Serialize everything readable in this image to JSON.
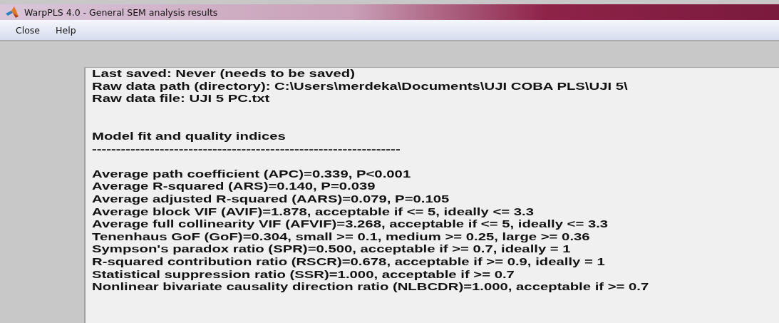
{
  "window": {
    "title": "WarpPLS 4.0 - General SEM analysis results"
  },
  "menu": [
    {
      "label": "Close"
    },
    {
      "label": "Help"
    }
  ],
  "results": {
    "header_lines": [
      "Last saved: Never (needs to be saved)",
      "Raw data path (directory): C:\\Users\\merdeka\\Documents\\UJI COBA PLS\\UJI 5\\",
      "Raw data file: UJI 5 PC.txt"
    ],
    "section_title": "Model fit and quality indices",
    "separator": "----------------------------------------------------------------",
    "indices": [
      "Average path coefficient (APC)=0.339, P<0.001",
      "Average R-squared (ARS)=0.140, P=0.039",
      "Average adjusted R-squared (AARS)=0.079, P=0.105",
      "Average block VIF (AVIF)=1.878, acceptable if <= 5, ideally <= 3.3",
      "Average full collinearity VIF (AFVIF)=3.268, acceptable if <= 5, ideally <= 3.3",
      "Tenenhaus GoF (GoF)=0.304, small >= 0.1, medium >= 0.25, large >= 0.36",
      "Sympson's paradox ratio (SPR)=0.500, acceptable if >= 0.7, ideally = 1",
      "R-squared contribution ratio (RSCR)=0.678, acceptable if >= 0.9, ideally = 1",
      "Statistical suppression ratio (SSR)=1.000, acceptable if >= 0.7",
      "Nonlinear bivariate causality direction ratio (NLBCDR)=1.000, acceptable if >= 0.7"
    ]
  }
}
